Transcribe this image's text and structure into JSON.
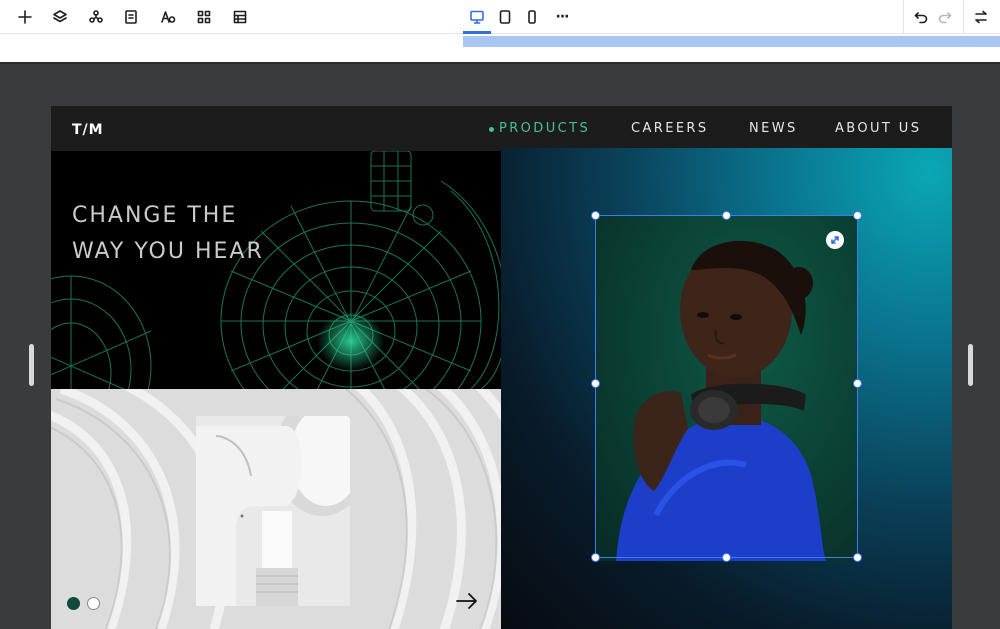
{
  "toolbar": {
    "left_tools": [
      "add-icon",
      "layers-icon",
      "components-icon",
      "pages-icon",
      "typography-icon",
      "apps-icon",
      "table-icon"
    ],
    "devices": [
      "desktop-icon",
      "tablet-icon",
      "mobile-icon"
    ],
    "more_label": "···",
    "right_tools": [
      "undo-icon",
      "redo-icon",
      "settings-toggle-icon"
    ],
    "accent": "#2f6fe0"
  },
  "site": {
    "logo": "T/M",
    "nav": [
      {
        "label": "PRODUCTS",
        "active": true
      },
      {
        "label": "CAREERS",
        "active": false
      },
      {
        "label": "NEWS",
        "active": false
      },
      {
        "label": "ABOUT US",
        "active": false
      }
    ],
    "hero": {
      "title_line1": "CHANGE THE",
      "title_line2": "WAY YOU HEAR"
    },
    "carousel": {
      "slide_count": 2,
      "active_index": 0,
      "next": "arrow-right-icon"
    },
    "colors": {
      "brand_green": "#47c08e",
      "dot_active": "#0f4a3a",
      "selection": "#3d7bf0"
    }
  }
}
